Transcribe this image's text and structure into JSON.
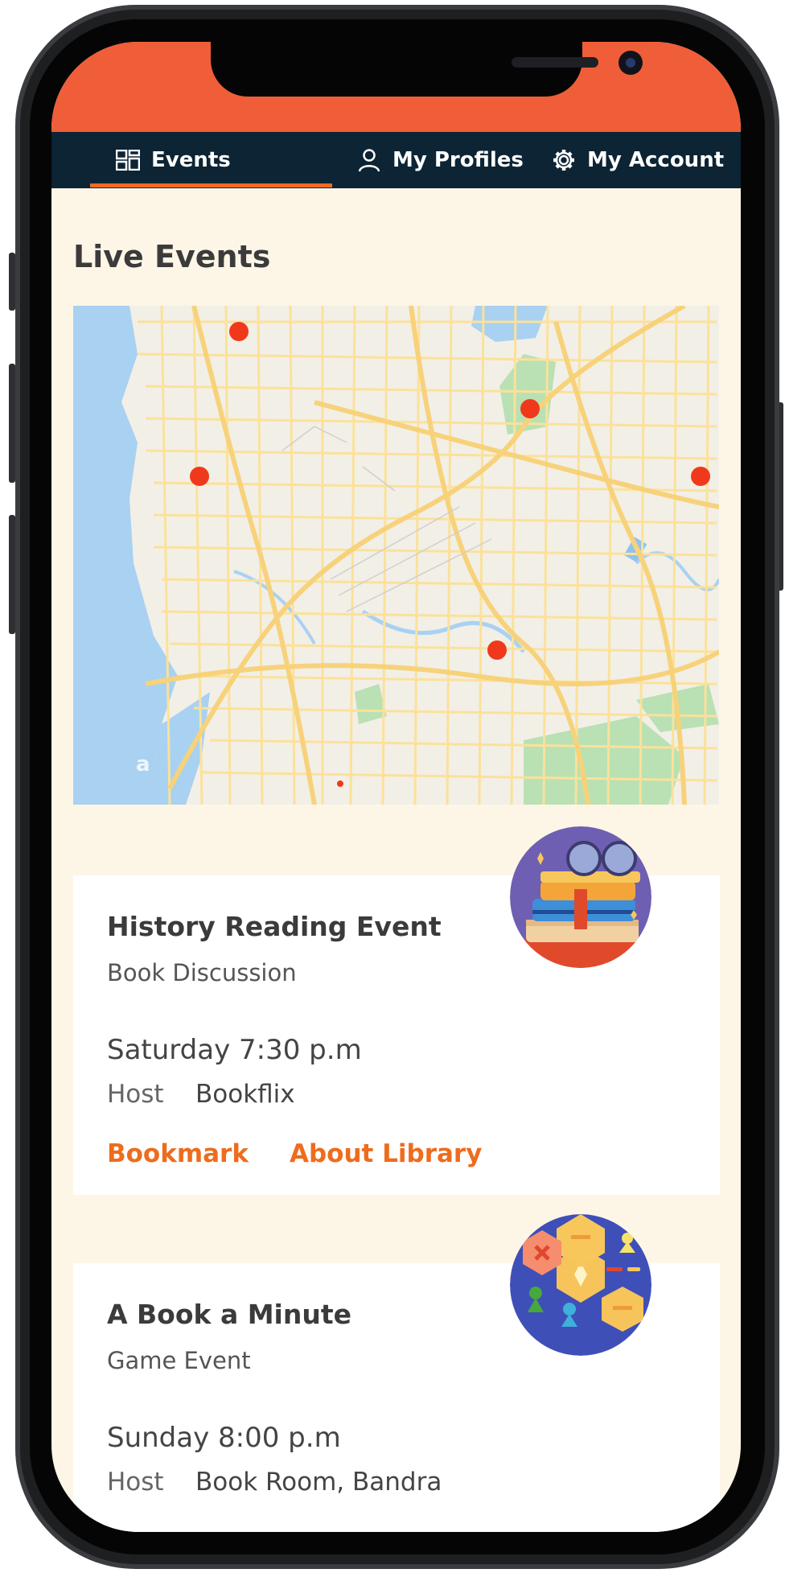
{
  "nav": {
    "items": [
      {
        "label": "Events",
        "icon": "grid-icon",
        "active": true
      },
      {
        "label": "My Profiles",
        "icon": "user-icon",
        "active": false
      },
      {
        "label": "My Account",
        "icon": "gear-icon",
        "active": false
      }
    ]
  },
  "page": {
    "title": "Live Events"
  },
  "map": {
    "marker_count": 6
  },
  "events": [
    {
      "title": "History Reading Event",
      "category": "Book Discussion",
      "time": "Saturday 7:30 p.m",
      "host_label": "Host",
      "host": "Bookflix",
      "actions": [
        "Bookmark",
        "About Library"
      ],
      "image": "books-stack-illustration"
    },
    {
      "title": "A Book a Minute",
      "category": "Game Event",
      "time": "Sunday 8:00 p.m",
      "host_label": "Host",
      "host": "Book Room, Bandra",
      "image": "board-game-illustration"
    }
  ],
  "colors": {
    "status_bar": "#ef5e38",
    "nav_bar": "#0c2434",
    "accent": "#ee6c1d",
    "background": "#fdf6e7",
    "marker": "#f0391c"
  }
}
